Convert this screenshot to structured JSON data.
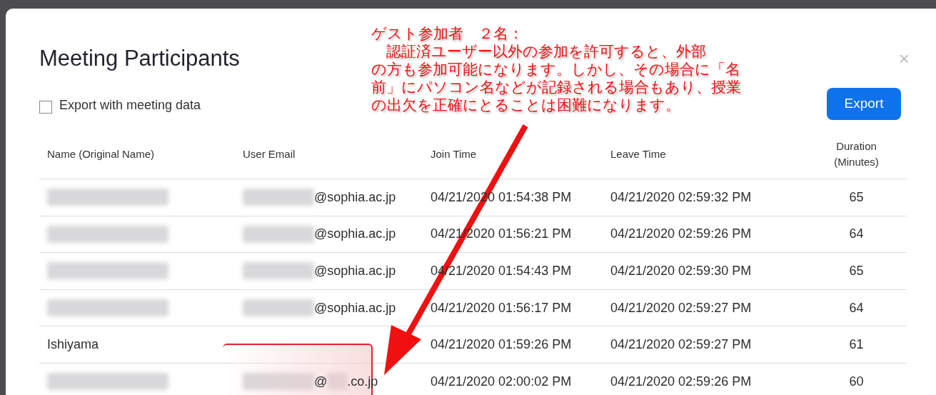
{
  "dialog": {
    "title": "Meeting Participants",
    "close": "×",
    "export_option": {
      "label": "Export with meeting data",
      "checked": false
    },
    "export_button": "Export"
  },
  "table": {
    "columns": [
      "Name (Original Name)",
      "User Email",
      "Join Time",
      "Leave Time",
      "Duration\n(Minutes)"
    ],
    "rows": [
      {
        "name": {
          "redacted": true
        },
        "email": [
          {
            "kind": "blur"
          },
          {
            "kind": "text",
            "text": "@sophia.ac.jp"
          }
        ],
        "join": "04/21/2020 01:54:38 PM",
        "leave": "04/21/2020 02:59:32 PM",
        "duration": "65"
      },
      {
        "name": {
          "redacted": true
        },
        "email": [
          {
            "kind": "blur"
          },
          {
            "kind": "text",
            "text": "@sophia.ac.jp"
          }
        ],
        "join": "04/21/2020 01:56:21 PM",
        "leave": "04/21/2020 02:59:26 PM",
        "duration": "64"
      },
      {
        "name": {
          "redacted": true
        },
        "email": [
          {
            "kind": "blur"
          },
          {
            "kind": "text",
            "text": "@sophia.ac.jp"
          }
        ],
        "join": "04/21/2020 01:54:43 PM",
        "leave": "04/21/2020 02:59:30 PM",
        "duration": "65"
      },
      {
        "name": {
          "redacted": true
        },
        "email": [
          {
            "kind": "blur"
          },
          {
            "kind": "text",
            "text": "@sophia.ac.jp"
          }
        ],
        "join": "04/21/2020 01:56:17 PM",
        "leave": "04/21/2020 02:59:27 PM",
        "duration": "64"
      },
      {
        "name": {
          "redacted": false,
          "text": "Ishiyama"
        },
        "email": [],
        "join": "04/21/2020 01:59:26 PM",
        "leave": "04/21/2020 02:59:27 PM",
        "duration": "61"
      },
      {
        "name": {
          "redacted": true
        },
        "email": [
          {
            "kind": "blur"
          },
          {
            "kind": "text",
            "text": "@"
          },
          {
            "kind": "blur"
          },
          {
            "kind": "text",
            "text": ".co.jp"
          }
        ],
        "join": "04/21/2020 02:00:02 PM",
        "leave": "04/21/2020 02:59:26 PM",
        "duration": "60"
      }
    ]
  },
  "annotation": {
    "lines": [
      "ゲスト参加者　２名：",
      "　認証済ユーザー以外の参加を許可すると、外部",
      "の方も参加可能になります。しかし、その場合に「名",
      "前」にパソコン名などが記録される場合もあり、授業",
      "の出欠を正確にとることは困難になります。"
    ]
  }
}
